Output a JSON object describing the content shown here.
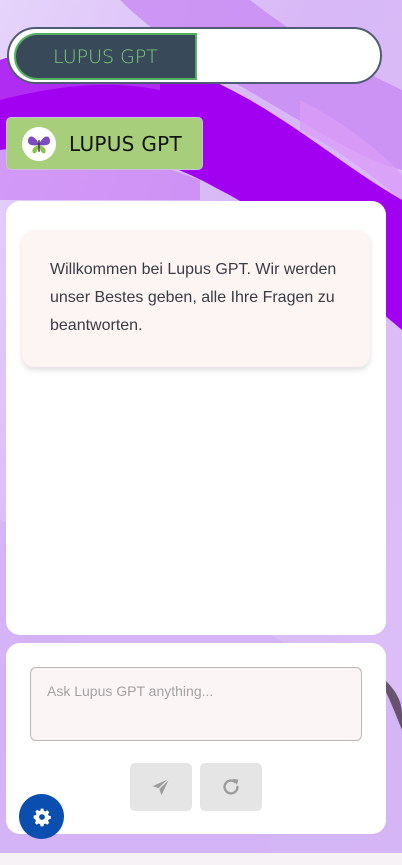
{
  "header": {
    "tab_label": "LUPUS GPT"
  },
  "brand": {
    "title": "LUPUS GPT",
    "logo_icon": "butterfly-icon"
  },
  "chat": {
    "welcome_message": "Willkommen bei Lupus GPT. Wir werden unser Bestes geben, alle Ihre Fragen zu beantworten."
  },
  "composer": {
    "placeholder": "Ask Lupus GPT anything...",
    "send_icon": "send-icon",
    "refresh_icon": "refresh-icon"
  },
  "settings": {
    "icon": "gear-icon"
  },
  "colors": {
    "background_accent": "#a400f0",
    "tab_bg": "#38495a",
    "tab_text": "#7ccd7a",
    "badge_bg": "#a7ce7a",
    "settings_button": "#0a4fb0"
  }
}
